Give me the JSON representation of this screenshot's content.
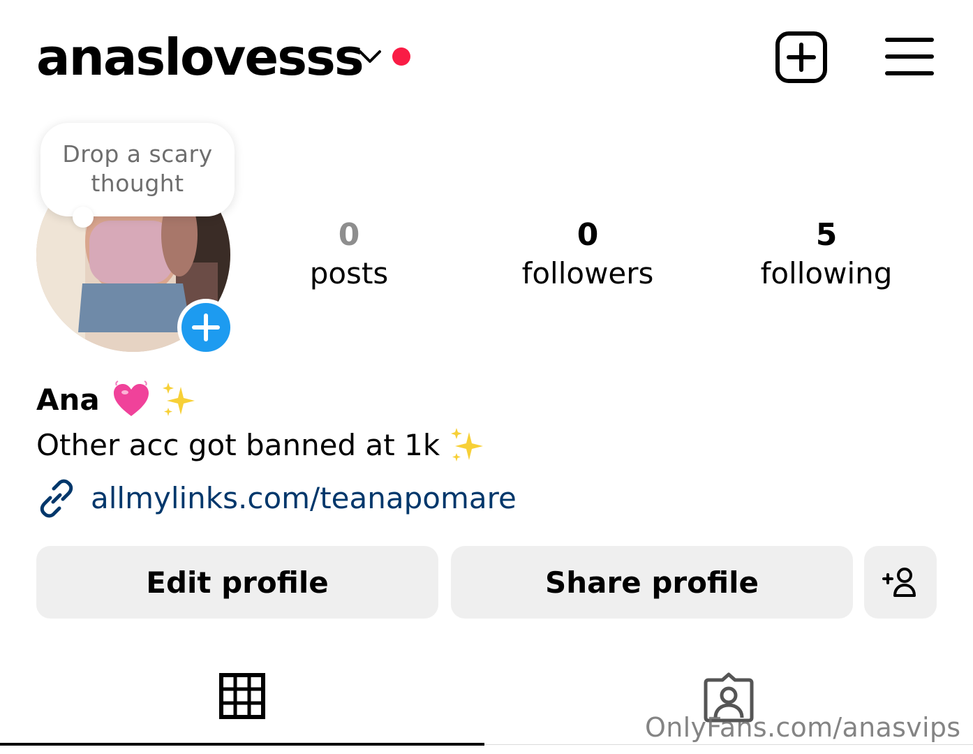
{
  "header": {
    "username": "anaslovesss",
    "icons": {
      "dropdown": "chevron-down-icon",
      "notification": "red-dot",
      "new_post": "plus-square-icon",
      "menu": "hamburger-menu-icon"
    }
  },
  "note": {
    "text": "Drop a scary thought"
  },
  "stats": [
    {
      "value": "0",
      "label": "posts"
    },
    {
      "value": "0",
      "label": "followers"
    },
    {
      "value": "5",
      "label": "following"
    }
  ],
  "profile": {
    "name": "Ana",
    "bio": "Other acc got banned at 1k",
    "link": "allmylinks.com/teanapomare"
  },
  "buttons": {
    "edit": "Edit profile",
    "share": "Share profile"
  },
  "tabs": {
    "grid": "grid-icon",
    "tagged": "tagged-person-icon"
  },
  "watermark": "OnlyFans.com/anasvips",
  "colors": {
    "accent_blue": "#1d9bf0",
    "notification_red": "#f91c45",
    "link_blue": "#00376b",
    "button_bg": "#efefef"
  }
}
